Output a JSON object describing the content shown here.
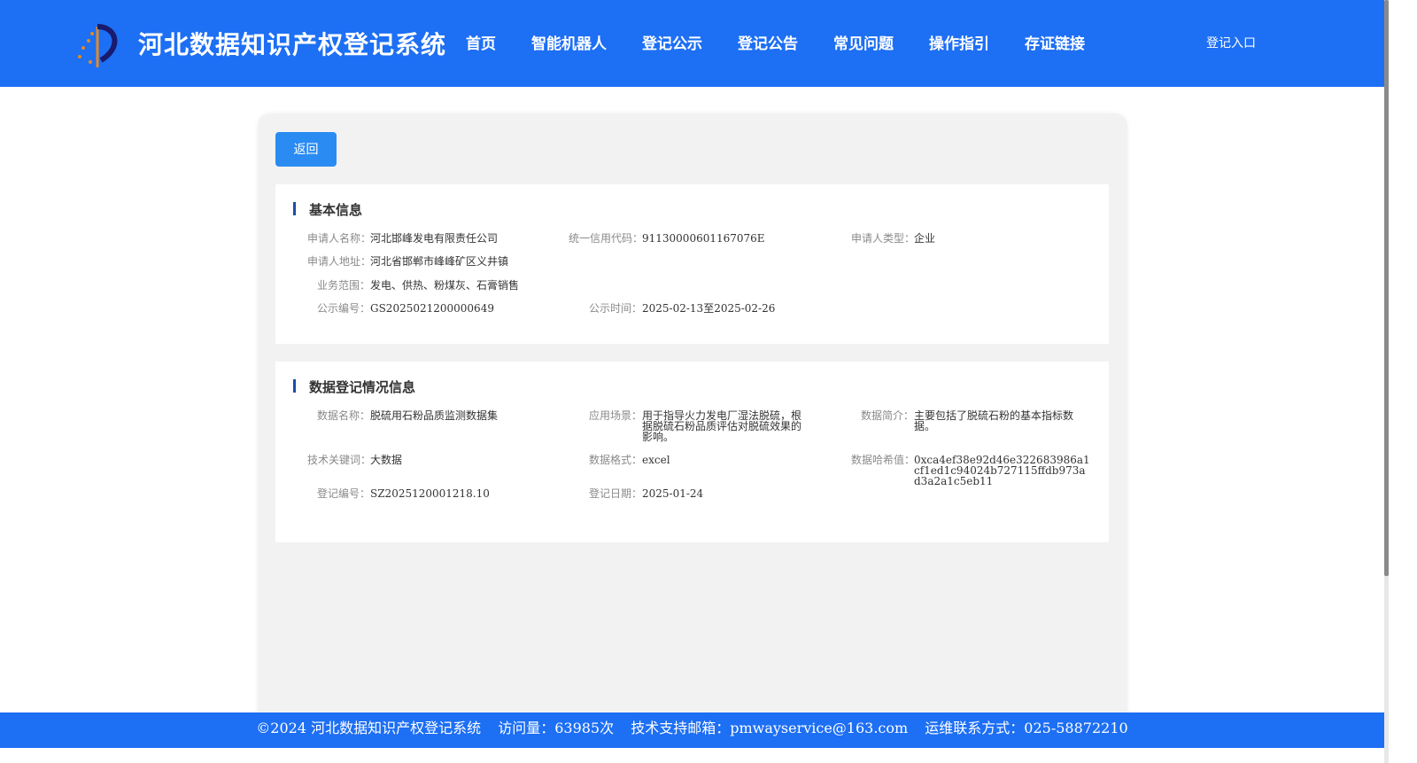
{
  "header": {
    "title": "河北数据知识产权登记系统",
    "nav": [
      "首页",
      "智能机器人",
      "登记公示",
      "登记公告",
      "常见问题",
      "操作指引",
      "存证链接"
    ],
    "login": "登记入口"
  },
  "back_button": "返回",
  "basic_info": {
    "title": "基本信息",
    "applicant_name": {
      "label": "申请人名称：",
      "value": "河北邯峰发电有限责任公司"
    },
    "credit_code": {
      "label": "统一信用代码：",
      "value": "91130000601167076E"
    },
    "applicant_type": {
      "label": "申请人类型：",
      "value": "企业"
    },
    "address": {
      "label": "申请人地址：",
      "value": "河北省邯郸市峰峰矿区义井镇"
    },
    "business_scope": {
      "label": "业务范围：",
      "value": "发电、供热、粉煤灰、石膏销售"
    },
    "notice_no": {
      "label": "公示编号：",
      "value": "GS2025021200000649"
    },
    "notice_time": {
      "label": "公示时间：",
      "value": "2025-02-13至2025-02-26"
    }
  },
  "data_info": {
    "title": "数据登记情况信息",
    "data_name": {
      "label": "数据名称：",
      "value": "脱硫用石粉品质监测数据集"
    },
    "scenario": {
      "label": "应用场景：",
      "value": "用于指导火力发电厂湿法脱硫，根据脱硫石粉品质评估对脱硫效果的影响。"
    },
    "summary": {
      "label": "数据简介：",
      "value": "主要包括了脱硫石粉的基本指标数据。"
    },
    "keywords": {
      "label": "技术关键词：",
      "value": "大数据"
    },
    "format": {
      "label": "数据格式：",
      "value": "excel"
    },
    "hash": {
      "label": "数据哈希值：",
      "value": "0xca4ef38e92d46e322683986a1cf1ed1c94024b727115ffdb973ad3a2a1c5eb11"
    },
    "reg_no": {
      "label": "登记编号：",
      "value": "SZ2025120001218.10"
    },
    "reg_date": {
      "label": "登记日期：",
      "value": "2025-01-24"
    }
  },
  "footer": {
    "copyright": "©2024 河北数据知识产权登记系统",
    "visits": "访问量：63985次",
    "email": "技术支持邮箱：pmwayservice@163.com",
    "phone": "运维联系方式：025-58872210"
  },
  "colors": {
    "primary": "#1d6ff4",
    "button": "#2a8cf3",
    "accent_bar": "#1a4ea8"
  }
}
